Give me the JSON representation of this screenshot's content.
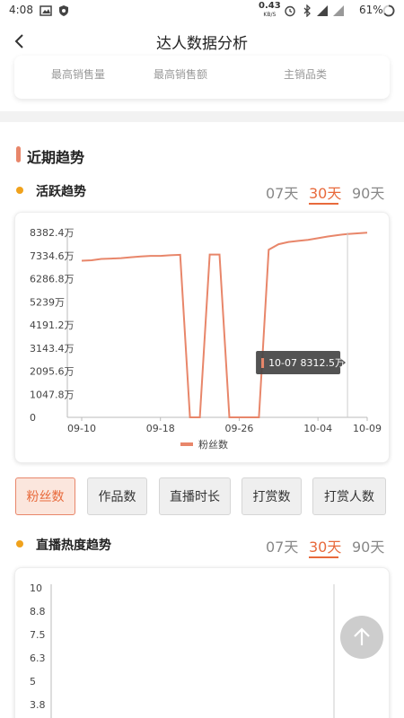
{
  "status_bar": {
    "time": "4:08",
    "net_speed": "0.43",
    "net_unit": "KB/S",
    "signal": "4G",
    "battery": "61%"
  },
  "header": {
    "title": "达人数据分析"
  },
  "top_stats": {
    "labels": [
      "最高销售量",
      "最高销售额",
      "主销品类"
    ]
  },
  "section": {
    "title": "近期趋势"
  },
  "active_trend": {
    "title": "活跃趋势",
    "ranges": [
      "07天",
      "30天",
      "90天"
    ],
    "active_range": "30天"
  },
  "metric_buttons": [
    "粉丝数",
    "作品数",
    "直播时长",
    "打赏数",
    "打赏人数"
  ],
  "active_metric": "粉丝数",
  "live_trend": {
    "title": "直播热度趋势",
    "ranges": [
      "07天",
      "30天",
      "90天"
    ],
    "active_range": "30天"
  },
  "colors": {
    "accent": "#e86a3c",
    "line": "#e8866a",
    "dot": "#f0a21c"
  },
  "chart_data": [
    {
      "type": "line",
      "y_tick_labels": [
        "0",
        "1047.8万",
        "2095.6万",
        "3143.4万",
        "4191.2万",
        "5239万",
        "6286.8万",
        "7334.6万",
        "8382.4万"
      ],
      "x_tick_labels": [
        "09-10",
        "09-18",
        "09-26",
        "10-04",
        "10-09"
      ],
      "ylim": [
        0,
        8382.4
      ],
      "y_unit": "万",
      "legend": "top-hidden",
      "series": [
        {
          "name": "粉丝数",
          "x": [
            "09-10",
            "09-11",
            "09-12",
            "09-13",
            "09-14",
            "09-15",
            "09-16",
            "09-17",
            "09-18",
            "09-19",
            "09-20",
            "09-21",
            "09-22",
            "09-23",
            "09-24",
            "09-25",
            "09-26",
            "09-27",
            "09-28",
            "09-29",
            "09-30",
            "10-01",
            "10-02",
            "10-03",
            "10-04",
            "10-05",
            "10-06",
            "10-07",
            "10-08",
            "10-09"
          ],
          "values": [
            7100,
            7120,
            7180,
            7200,
            7220,
            7260,
            7290,
            7320,
            7320,
            7350,
            7370,
            0,
            0,
            7380,
            7380,
            0,
            0,
            0,
            0,
            7600,
            7850,
            7950,
            8000,
            8050,
            8120,
            8200,
            8260,
            8312.5,
            8340,
            8370
          ]
        }
      ],
      "tooltip": {
        "date": "10-07",
        "value": "8312.5万"
      },
      "legend_label": "粉丝数"
    },
    {
      "type": "line",
      "y_tick_labels": [
        "10",
        "8.8",
        "7.5",
        "6.3",
        "5",
        "3.8"
      ],
      "ylim": [
        3.8,
        10
      ]
    }
  ]
}
